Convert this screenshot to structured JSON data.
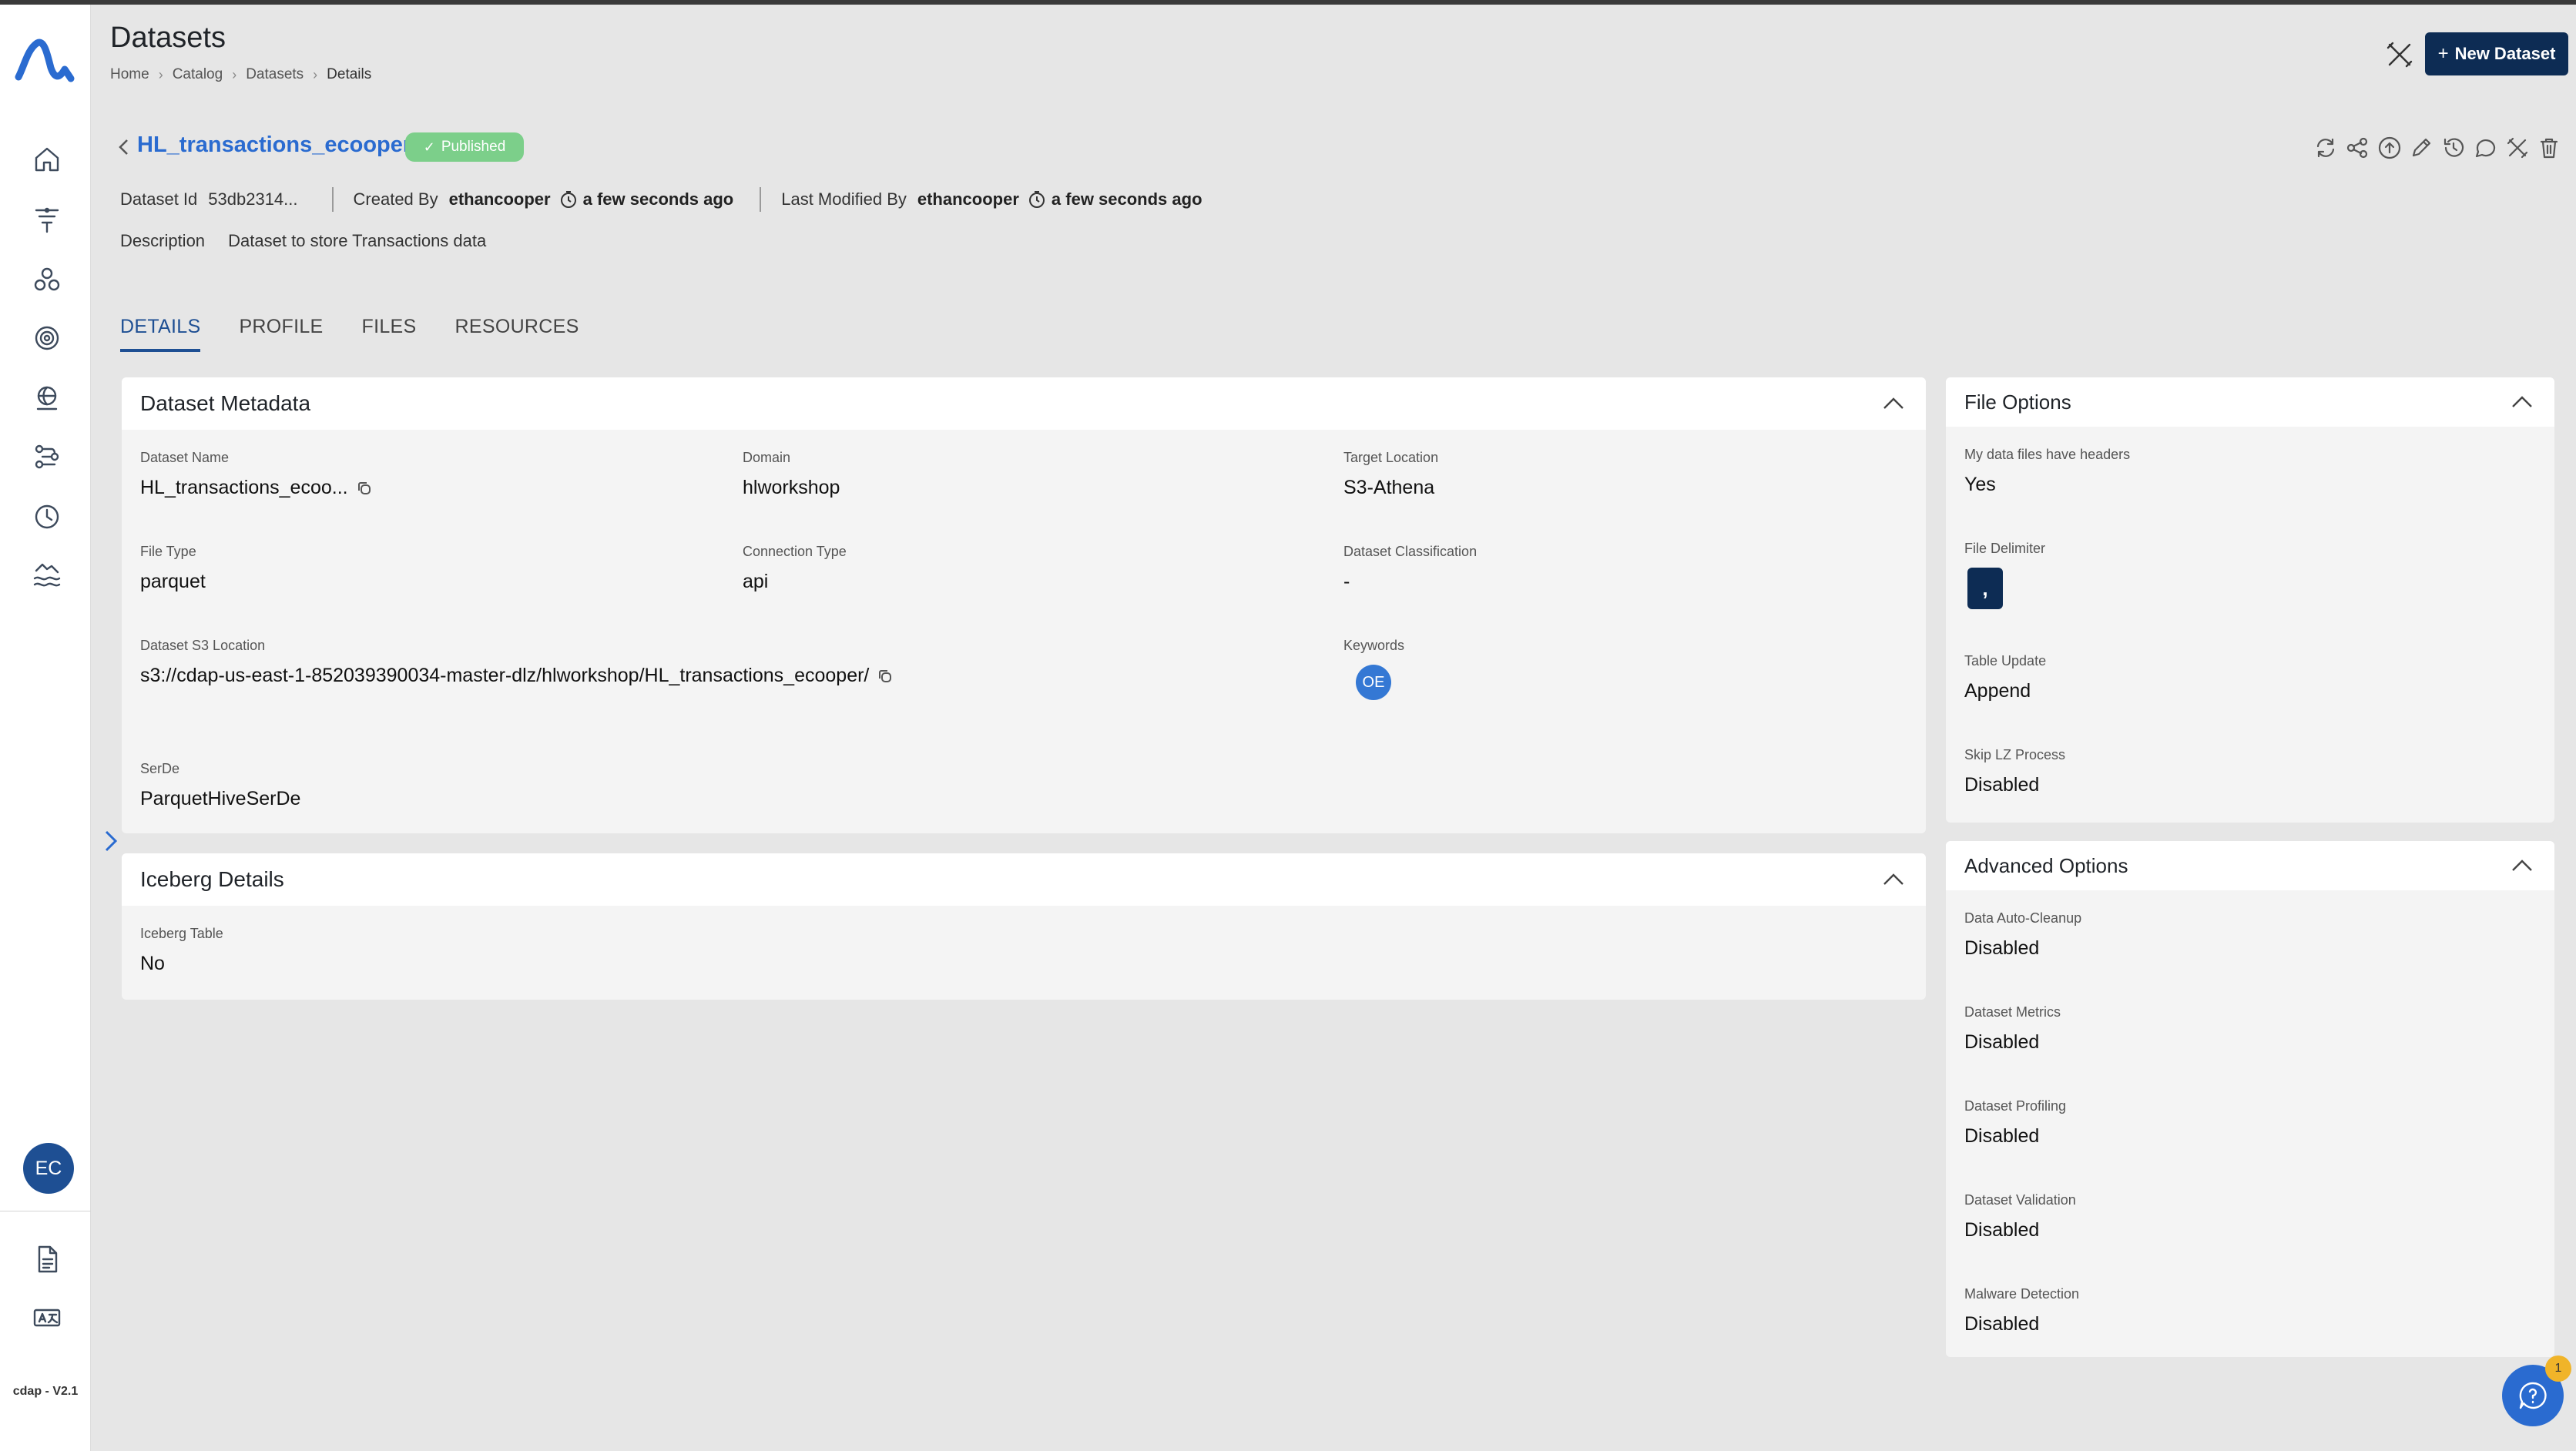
{
  "header": {
    "title": "Datasets",
    "breadcrumb": [
      "Home",
      "Catalog",
      "Datasets",
      "Details"
    ],
    "new_button_label": "New Dataset"
  },
  "sidebar": {
    "nav_items": [
      "home-icon",
      "filter-funnel-icon",
      "group-circles-icon",
      "target-settings-icon",
      "globe-icon",
      "workflow-icon",
      "clock-icon",
      "data-lake-icon"
    ],
    "bottom_items": [
      "document-icon",
      "translate-icon"
    ],
    "user_initials": "EC",
    "version": "cdap - V2.1"
  },
  "dataset": {
    "name": "HL_transactions_ecooper",
    "status": "Published",
    "id_label": "Dataset Id",
    "id_value": "53db2314...",
    "created_label": "Created By",
    "created_user": "ethancooper",
    "created_time": "a few seconds ago",
    "modified_label": "Last Modified By",
    "modified_user": "ethancooper",
    "modified_time": "a few seconds ago",
    "description_label": "Description",
    "description": "Dataset to store Transactions data",
    "actions": [
      "refresh-icon",
      "share-icon",
      "upload-icon",
      "edit-pencil-icon",
      "history-icon",
      "comment-icon",
      "tools-icon",
      "delete-icon"
    ]
  },
  "tabs": [
    "DETAILS",
    "PROFILE",
    "FILES",
    "RESOURCES"
  ],
  "metadata_card": {
    "title": "Dataset Metadata",
    "dataset_name": {
      "label": "Dataset Name",
      "value": "HL_transactions_ecoo..."
    },
    "domain": {
      "label": "Domain",
      "value": "hlworkshop"
    },
    "target_location": {
      "label": "Target Location",
      "value": "S3-Athena"
    },
    "file_type": {
      "label": "File Type",
      "value": "parquet"
    },
    "connection_type": {
      "label": "Connection Type",
      "value": "api"
    },
    "classification": {
      "label": "Dataset Classification",
      "value": "-"
    },
    "s3_location": {
      "label": "Dataset S3 Location",
      "value": "s3://cdap-us-east-1-852039390034-master-dlz/hlworkshop/HL_transactions_ecooper/"
    },
    "keywords": {
      "label": "Keywords",
      "badge": "OE"
    },
    "serde": {
      "label": "SerDe",
      "value": "ParquetHiveSerDe"
    }
  },
  "iceberg_card": {
    "title": "Iceberg Details",
    "iceberg_table": {
      "label": "Iceberg Table",
      "value": "No"
    }
  },
  "file_options_card": {
    "title": "File Options",
    "headers": {
      "label": "My data files have headers",
      "value": "Yes"
    },
    "delimiter": {
      "label": "File Delimiter",
      "value": ","
    },
    "table_update": {
      "label": "Table Update",
      "value": "Append"
    },
    "skip_lz": {
      "label": "Skip LZ Process",
      "value": "Disabled"
    }
  },
  "advanced_card": {
    "title": "Advanced Options",
    "auto_cleanup": {
      "label": "Data Auto-Cleanup",
      "value": "Disabled"
    },
    "metrics": {
      "label": "Dataset Metrics",
      "value": "Disabled"
    },
    "profiling": {
      "label": "Dataset Profiling",
      "value": "Disabled"
    },
    "validation": {
      "label": "Dataset Validation",
      "value": "Disabled"
    },
    "malware": {
      "label": "Malware Detection",
      "value": "Disabled"
    }
  },
  "help": {
    "notification_count": "1"
  },
  "colors": {
    "accent": "#2a6bd0",
    "primary_dark": "#0d2c54",
    "published": "#7ccf8a",
    "badge": "#f0b429"
  }
}
